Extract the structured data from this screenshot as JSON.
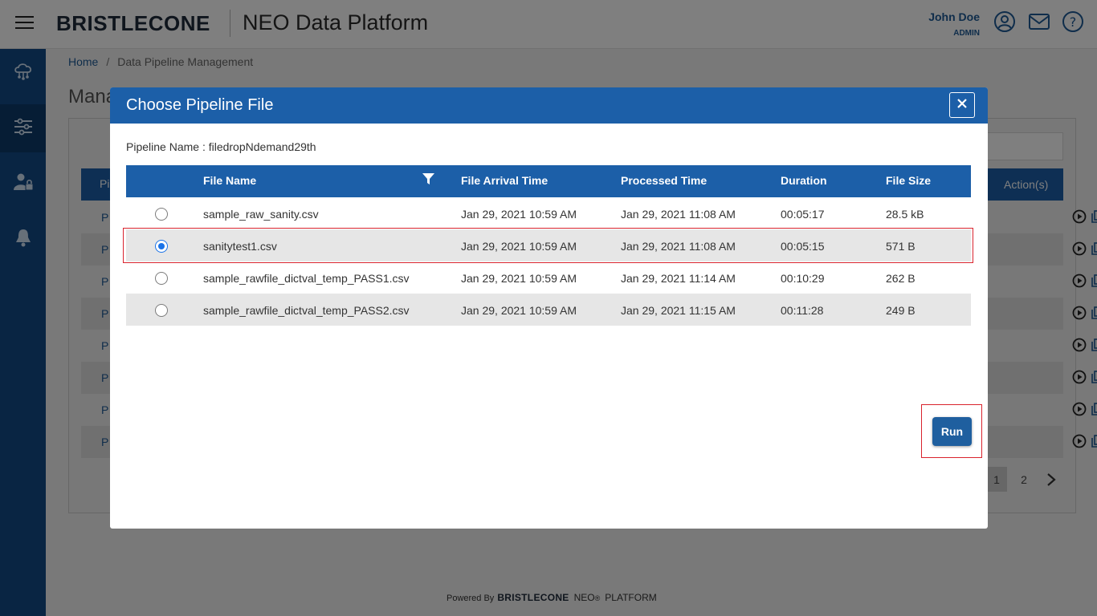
{
  "header": {
    "logo_text": "BRISTLECONE",
    "app_title": "NEO Data Platform",
    "user_name": "John Doe",
    "user_role": "ADMIN",
    "icons": [
      "menu-icon",
      "user-circle-icon",
      "mail-icon",
      "help-icon"
    ]
  },
  "sidebar": {
    "items": [
      {
        "icon": "cloud-network-icon"
      },
      {
        "icon": "pipeline-sliders-icon",
        "active": true
      },
      {
        "icon": "user-lock-icon"
      },
      {
        "icon": "bell-icon"
      }
    ]
  },
  "breadcrumb": {
    "home": "Home",
    "separator": "/",
    "current": "Data Pipeline Management"
  },
  "background": {
    "page_title": "Mana",
    "table_first_header": "Pi",
    "actions_header": "Action(s)",
    "row_prefix": "P",
    "rows": 8,
    "pagination": {
      "pages": [
        "1",
        "2"
      ],
      "current": "1"
    }
  },
  "modal": {
    "title": "Choose Pipeline File",
    "pipeline_label": "Pipeline Name : filedropNdemand29th",
    "columns": {
      "file_name": "File Name",
      "arrival": "File Arrival Time",
      "processed": "Processed Time",
      "duration": "Duration",
      "size": "File Size"
    },
    "rows": [
      {
        "name": "sample_raw_sanity.csv",
        "arrival": "Jan 29, 2021 10:59 AM",
        "processed": "Jan 29, 2021 11:08 AM",
        "duration": "00:05:17",
        "size": "28.5 kB",
        "selected": false
      },
      {
        "name": "sanitytest1.csv",
        "arrival": "Jan 29, 2021 10:59 AM",
        "processed": "Jan 29, 2021 11:08 AM",
        "duration": "00:05:15",
        "size": "571 B",
        "selected": true
      },
      {
        "name": "sample_rawfile_dictval_temp_PASS1.csv",
        "arrival": "Jan 29, 2021 10:59 AM",
        "processed": "Jan 29, 2021 11:14 AM",
        "duration": "00:10:29",
        "size": "262 B",
        "selected": false
      },
      {
        "name": "sample_rawfile_dictval_temp_PASS2.csv",
        "arrival": "Jan 29, 2021 10:59 AM",
        "processed": "Jan 29, 2021 11:15 AM",
        "duration": "00:11:28",
        "size": "249 B",
        "selected": false
      }
    ],
    "run_label": "Run"
  },
  "footer": {
    "powered_by": "Powered By",
    "brand": "BRISTLECONE",
    "neo": "NEO",
    "reg": "®",
    "platform": "PLATFORM"
  },
  "colors": {
    "primary": "#1c5fa8",
    "sidebar": "#124a87",
    "highlight": "#d9232d",
    "radio": "#1a73e8"
  }
}
